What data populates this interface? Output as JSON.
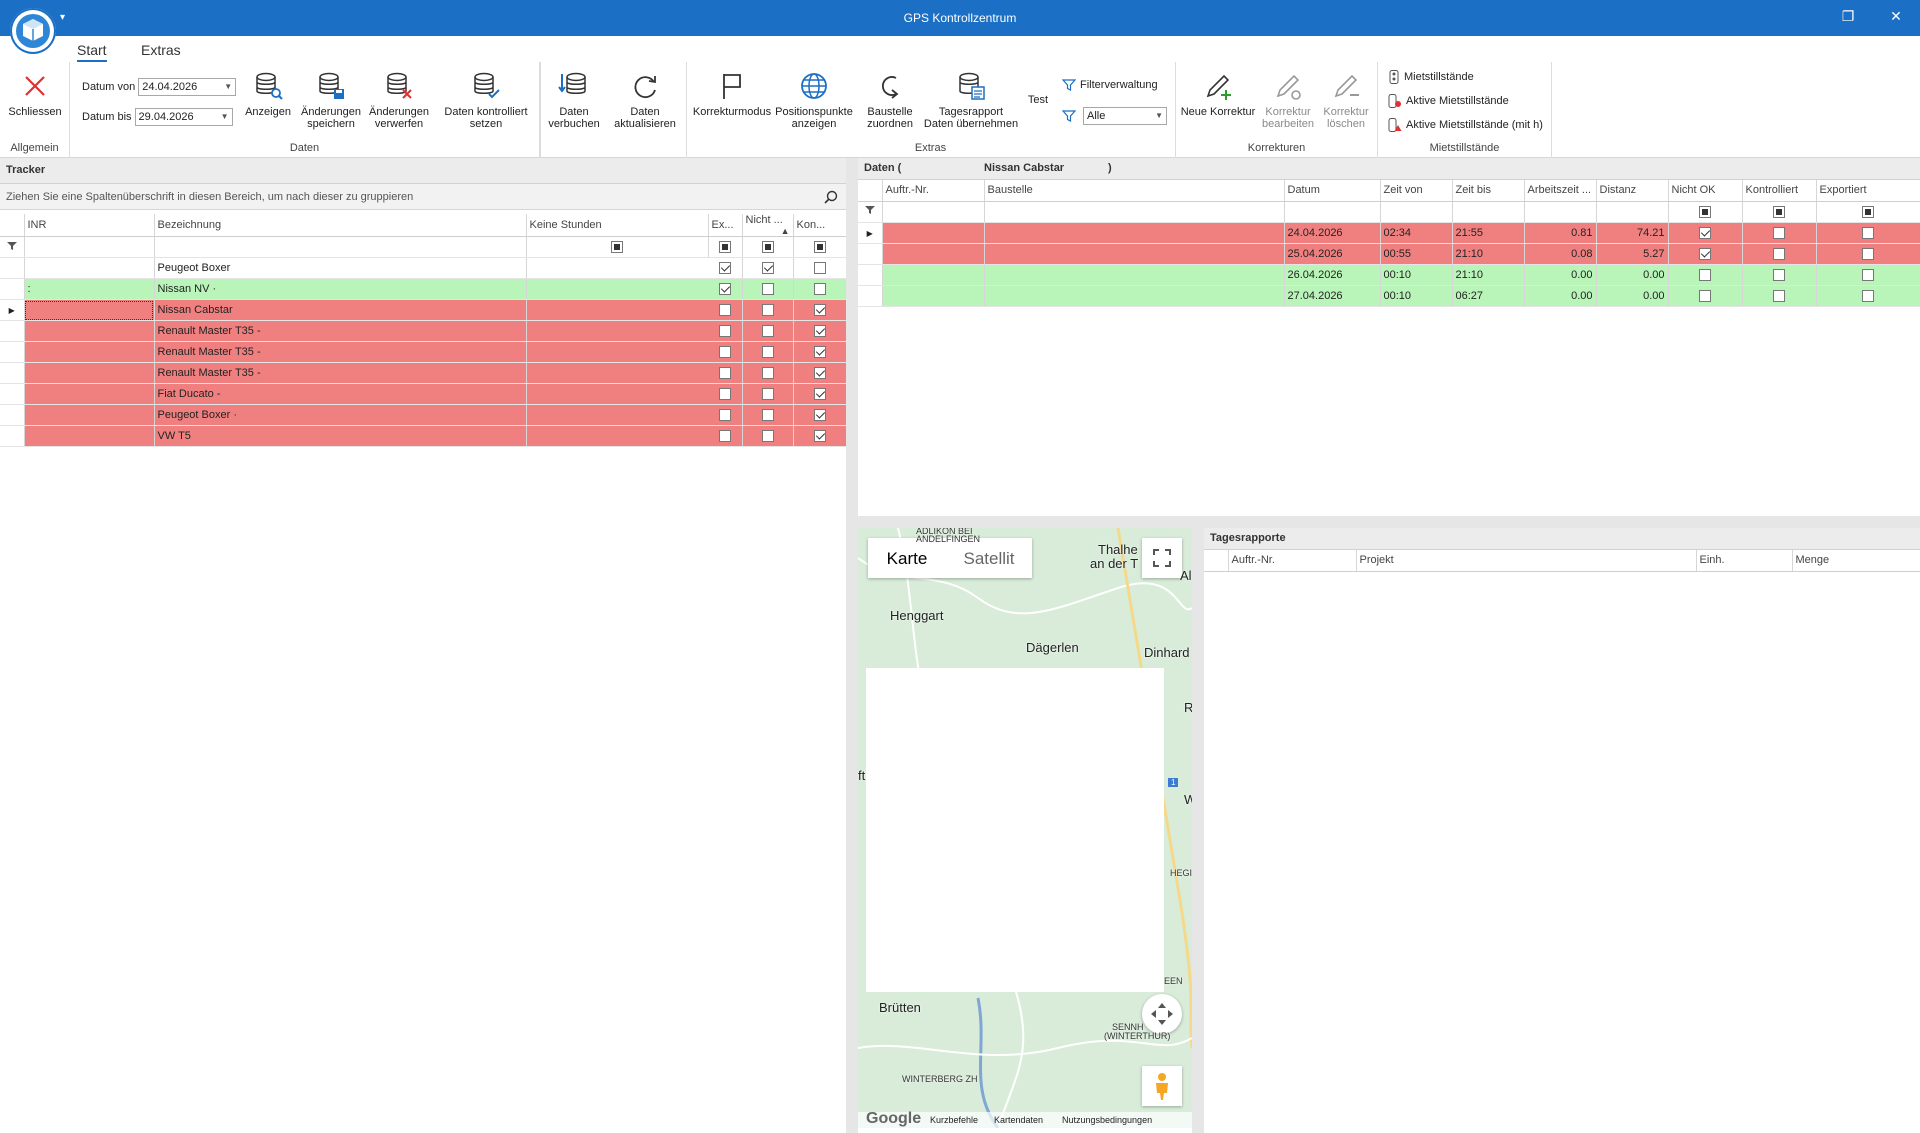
{
  "window": {
    "title": "GPS Kontrollzentrum"
  },
  "ribbon": {
    "tabs": [
      {
        "label": "Start"
      },
      {
        "label": "Extras"
      }
    ],
    "groups": {
      "allgemein": {
        "label": "Allgemein",
        "close_label": "Schliessen"
      },
      "daten": {
        "label": "Daten",
        "datum_von_label": "Datum von",
        "datum_von_value": "24.04.2026",
        "datum_bis_label": "Datum bis",
        "datum_bis_value": "29.04.2026",
        "anzeigen": "Anzeigen",
        "save_line1": "Änderungen",
        "save_line2": "speichern",
        "discard_line1": "Änderungen",
        "discard_line2": "verwerfen",
        "kontrolliert_line1": "Daten kontrolliert",
        "kontrolliert_line2": "setzen",
        "verbuchen_line1": "Daten",
        "verbuchen_line2": "verbuchen",
        "aktualisieren_line1": "Daten",
        "aktualisieren_line2": "aktualisieren"
      },
      "extras": {
        "label": "Extras",
        "korrekturmodus": "Korrekturmodus",
        "positions_line1": "Positionspunkte",
        "positions_line2": "anzeigen",
        "baustelle_line1": "Baustelle",
        "baustelle_line2": "zuordnen",
        "tagesrapport_line1": "Tagesrapport",
        "tagesrapport_line2": "Daten übernehmen",
        "test": "Test",
        "filterverwaltung": "Filterverwaltung",
        "filter_value": "Alle"
      },
      "korrekturen": {
        "label": "Korrekturen",
        "neue": "Neue Korrektur",
        "bearbeiten_line1": "Korrektur",
        "bearbeiten_line2": "bearbeiten",
        "loeschen_line1": "Korrektur",
        "loeschen_line2": "löschen"
      },
      "mietstillstaende": {
        "label": "Mietstillstände",
        "item1": "Mietstillstände",
        "item2": "Aktive Mietstillstände",
        "item3": "Aktive Mietstillstände (mit h)"
      }
    }
  },
  "tracker": {
    "title": "Tracker",
    "group_hint": "Ziehen Sie eine Spaltenüberschrift in diesen Bereich, um nach dieser zu gruppieren",
    "columns": [
      "INR",
      "Bezeichnung",
      "Keine Stunden",
      "Ex...",
      "Nicht ...",
      "Kon..."
    ],
    "rows": [
      {
        "inr": "",
        "bez": "Peugeot Boxer",
        "status": "white",
        "keine": true,
        "ex": true,
        "nicht": false,
        "kon": true
      },
      {
        "inr": ":",
        "bez": "Nissan NV ·",
        "status": "green",
        "keine": true,
        "ex": false,
        "nicht": false,
        "kon": false
      },
      {
        "inr": "",
        "bez": "Nissan Cabstar",
        "status": "red",
        "keine": false,
        "ex": false,
        "nicht": true,
        "kon": false
      },
      {
        "inr": "",
        "bez": "Renault Master T35 -",
        "status": "red",
        "keine": false,
        "ex": false,
        "nicht": true,
        "kon": false
      },
      {
        "inr": "",
        "bez": "Renault Master T35 -",
        "status": "red",
        "keine": false,
        "ex": false,
        "nicht": true,
        "kon": false
      },
      {
        "inr": "",
        "bez": "Renault Master T35 -",
        "status": "red",
        "keine": false,
        "ex": false,
        "nicht": true,
        "kon": false
      },
      {
        "inr": "",
        "bez": "Fiat Ducato -",
        "status": "red",
        "keine": false,
        "ex": false,
        "nicht": true,
        "kon": false
      },
      {
        "inr": "",
        "bez": "Peugeot Boxer ·",
        "status": "red",
        "keine": false,
        "ex": false,
        "nicht": true,
        "kon": false
      },
      {
        "inr": "",
        "bez": "VW T5",
        "status": "red",
        "keine": false,
        "ex": false,
        "nicht": true,
        "kon": false
      }
    ]
  },
  "daten": {
    "title_prefix": "Daten (",
    "vehicle": "Nissan Cabstar",
    "title_suffix": ")",
    "columns": [
      "Auftr.-Nr.",
      "Baustelle",
      "Datum",
      "Zeit von",
      "Zeit bis",
      "Arbeitszeit ...",
      "Distanz",
      "Nicht OK",
      "Kontrolliert",
      "Exportiert"
    ],
    "rows": [
      {
        "datum": "24.04.2026",
        "von": "02:34",
        "bis": "21:55",
        "arbeit": "0.81",
        "distanz": "74.21",
        "status": "red",
        "nichtok": true,
        "kontrolliert": false,
        "exportiert": false
      },
      {
        "datum": "25.04.2026",
        "von": "00:55",
        "bis": "21:10",
        "arbeit": "0.08",
        "distanz": "5.27",
        "status": "red",
        "nichtok": true,
        "kontrolliert": false,
        "exportiert": false
      },
      {
        "datum": "26.04.2026",
        "von": "00:10",
        "bis": "21:10",
        "arbeit": "0.00",
        "distanz": "0.00",
        "status": "green",
        "nichtok": false,
        "kontrolliert": false,
        "exportiert": false
      },
      {
        "datum": "27.04.2026",
        "von": "00:10",
        "bis": "06:27",
        "arbeit": "0.00",
        "distanz": "0.00",
        "status": "green",
        "nichtok": false,
        "kontrolliert": false,
        "exportiert": false
      }
    ]
  },
  "map": {
    "tab_karte": "Karte",
    "tab_satellit": "Satellit",
    "labels": {
      "henggart": "Henggart",
      "daegerlen": "Dägerlen",
      "dinhard": "Dinhard",
      "thalheim1": "Thalhe",
      "thalheim2": "an der T",
      "bruetten": "Brütten",
      "winterberg": "WINTERBERG ZH",
      "sennhof1": "SENNH",
      "sennhof2": "(WINTERTHUR)",
      "adlikon": "ADLIKON BEI",
      "andelfingen": "ANDELFINGEN",
      "al": "Al",
      "ft": "ft",
      "r": "R",
      "w": "W",
      "hegi": "HEGI",
      "een": "EEN",
      "route": "1"
    },
    "footer": {
      "google": "Google",
      "kurzbefehle": "Kurzbefehle",
      "kartendaten": "Kartendaten",
      "nutzung": "Nutzungsbedingungen"
    }
  },
  "tagesrapporte": {
    "title": "Tagesrapporte",
    "columns": [
      "Auftr.-Nr.",
      "Projekt",
      "Einh.",
      "Menge"
    ]
  },
  "colors": {
    "titlebar": "#1b6fc4",
    "row_red": "#f08080",
    "row_green": "#b9f5b9"
  }
}
